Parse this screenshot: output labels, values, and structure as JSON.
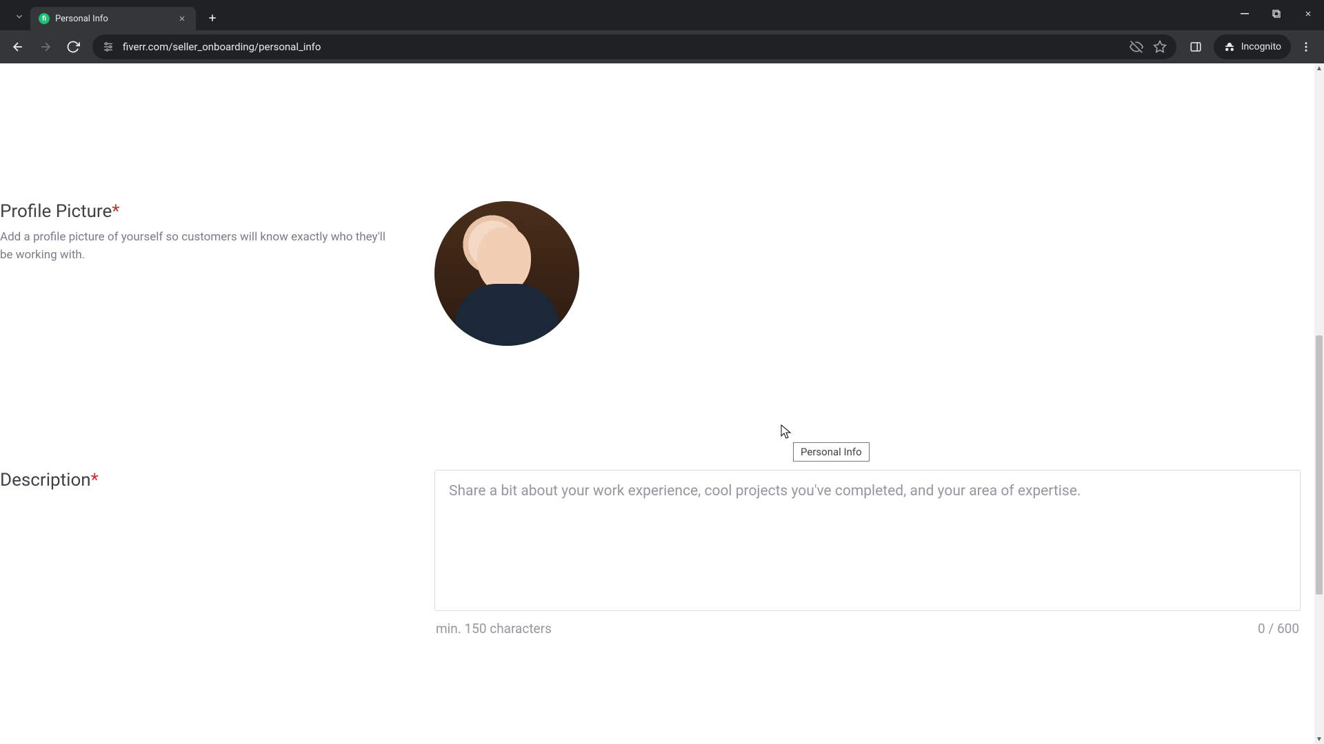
{
  "browser": {
    "tab_title": "Personal Info",
    "url": "fiverr.com/seller_onboarding/personal_info",
    "incognito_label": "Incognito"
  },
  "tooltip": {
    "text": "Personal Info"
  },
  "profile_picture": {
    "heading": "Profile Picture",
    "required_mark": "*",
    "help": "Add a profile picture of yourself so customers will know exactly who they'll be working with."
  },
  "description": {
    "heading": "Description",
    "required_mark": "*",
    "placeholder": "Share a bit about your work experience, cool projects you've completed, and your area of expertise.",
    "min_hint": "min. 150 characters",
    "count": "0 / 600"
  }
}
